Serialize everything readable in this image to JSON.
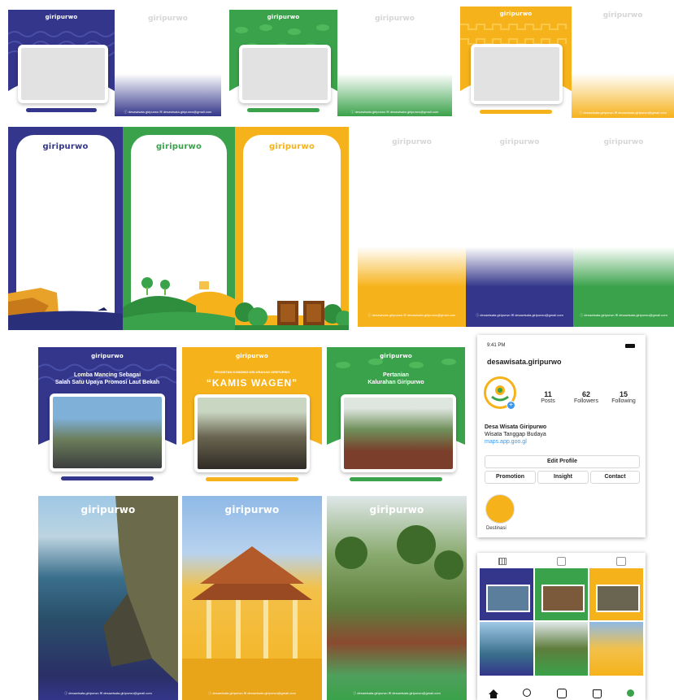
{
  "brand": "giripurwo",
  "colors": {
    "blue": "#33368a",
    "green": "#3aa24a",
    "yellow": "#f6b21b"
  },
  "contact": {
    "ig": "@desawisata.giripurwo",
    "email": "desawisata.giripurwo@gmail.com",
    "line": "ⓘ desawisata.giripurwo   ✉ desawisata.giripurwo@gmail.com"
  },
  "posts": [
    {
      "title": "Lomba Mancing Sebagai\nSalah Satu Upaya Promosi Laut Bekah"
    },
    {
      "kicker": "PENGETAN KONDING KELURAHAN GIRIPURWO",
      "title": "“KAMIS WAGEN”"
    },
    {
      "title": "Pertanian\nKalurahan Giripurwo"
    }
  ],
  "instagram": {
    "time": "9:41 PM",
    "username": "desawisata.giripurwo",
    "posts_count": "11",
    "posts_label": "Posts",
    "followers_count": "62",
    "followers_label": "Followers",
    "following_count": "15",
    "following_label": "Following",
    "name": "Desa Wisata Giripurwo",
    "bio": "Wisata Tanggap Budaya",
    "link": "maps.app.goo.gl",
    "edit_profile": "Edit Profile",
    "promotion": "Promotion",
    "insight": "Insight",
    "contact": "Contact",
    "highlight": "Destinasi"
  },
  "grid_preview": {
    "title1": "Lomba Mancing Sebagai Salah Satu Upaya Promosi Laut Bekah",
    "title2": "Pertanian Kalurahan Giripurwo",
    "title3": "KAMIS WAGEN"
  },
  "icons": [
    "grid-icon",
    "reels-icon",
    "tagged-icon",
    "home-icon",
    "search-icon",
    "reels-nav-icon",
    "shop-icon",
    "profile-icon"
  ]
}
